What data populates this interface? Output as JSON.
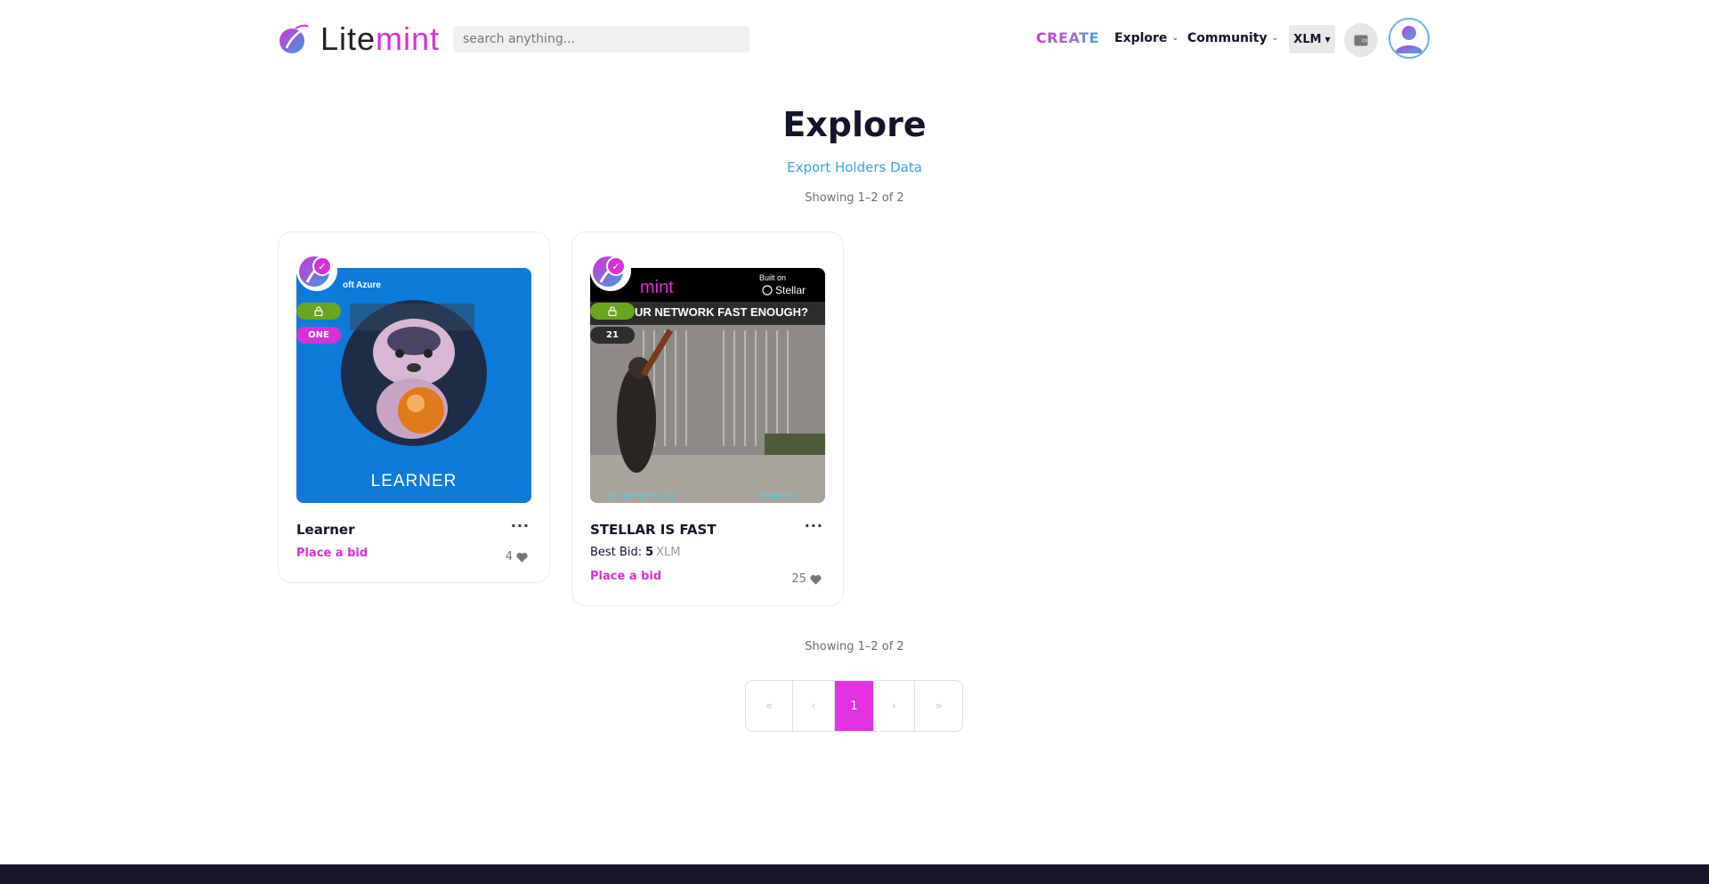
{
  "header": {
    "logo_prefix": "Lite",
    "logo_suffix": "mint",
    "search_placeholder": "search anything...",
    "create_label": "CREATE",
    "explore_label": "Explore",
    "community_label": "Community",
    "currency_label": "XLM",
    "brand_colors": {
      "accent": "#d631d6",
      "blue": "#4fa3e0",
      "footer": "#15142a"
    }
  },
  "page": {
    "title": "Explore",
    "export_link": "Export Holders Data",
    "showing_top": "Showing 1–2 of 2",
    "showing_bottom": "Showing 1–2 of 2"
  },
  "cards": [
    {
      "name": "Learner",
      "badge": "ONE",
      "media_caption": "LEARNER",
      "media_header": "oft Azure",
      "action": "Place a bid",
      "likes": "4"
    },
    {
      "name": "STELLAR IS FAST",
      "badge": "21",
      "media_logo": "mint",
      "media_built_on": "Built on",
      "media_stellar": "Stellar",
      "media_headline": "UR NETWORK FAST ENOUGH?",
      "media_footer_left": "NFT MARKETPLACE",
      "media_footer_right": "LITEMINT.IO",
      "best_bid_label": "Best Bid:",
      "best_bid_amount": "5",
      "best_bid_currency": "XLM",
      "action": "Place a bid",
      "likes": "25"
    }
  ],
  "pagination": {
    "first": "«",
    "prev": "‹",
    "current": "1",
    "next": "›",
    "last": "»"
  }
}
